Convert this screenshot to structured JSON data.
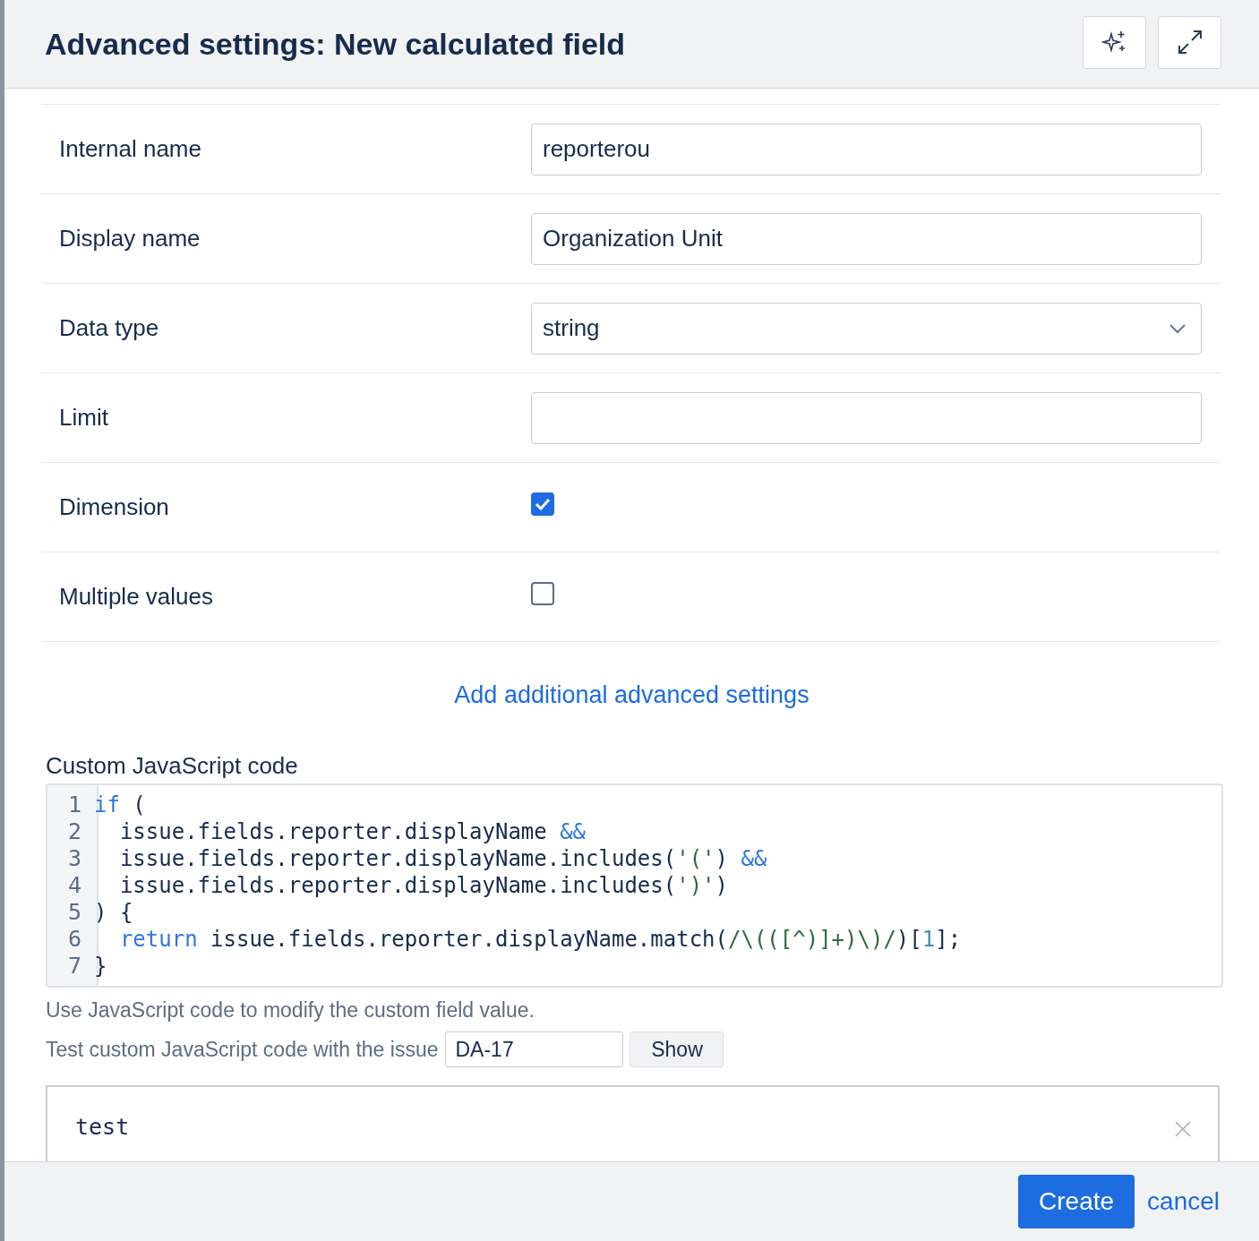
{
  "dialog": {
    "title": "Advanced settings: New calculated field"
  },
  "settings": [
    {
      "kind": "text",
      "label": "Internal name",
      "value": "reporterou"
    },
    {
      "kind": "text",
      "label": "Display name",
      "value": "Organization Unit"
    },
    {
      "kind": "select",
      "label": "Data type",
      "value": "string"
    },
    {
      "kind": "text",
      "label": "Limit"
    },
    {
      "kind": "checkbox",
      "label": "Dimension",
      "checked": true
    },
    {
      "kind": "checkbox",
      "label": "Multiple values",
      "checked": false
    }
  ],
  "add_settings_link": "Add additional advanced settings",
  "code_editor": {
    "label": "Custom JavaScript code",
    "lines": [
      {
        "number": "1",
        "tokens": [
          {
            "kind": "keyword",
            "text": "if"
          },
          {
            "kind": "plain",
            "text": " ("
          }
        ]
      },
      {
        "number": "2",
        "tokens": [
          {
            "kind": "plain",
            "text": "  issue.fields.reporter.displayName "
          },
          {
            "kind": "keyword",
            "text": "&&"
          }
        ]
      },
      {
        "number": "3",
        "tokens": [
          {
            "kind": "plain",
            "text": "  issue.fields.reporter.displayName.includes("
          },
          {
            "kind": "string",
            "text": "'('"
          },
          {
            "kind": "plain",
            "text": ") "
          },
          {
            "kind": "keyword",
            "text": "&&"
          }
        ]
      },
      {
        "number": "4",
        "tokens": [
          {
            "kind": "plain",
            "text": "  issue.fields.reporter.displayName.includes("
          },
          {
            "kind": "string",
            "text": "')'"
          },
          {
            "kind": "plain",
            "text": ")"
          }
        ]
      },
      {
        "number": "5",
        "tokens": [
          {
            "kind": "plain",
            "text": ") {"
          }
        ]
      },
      {
        "number": "6",
        "tokens": [
          {
            "kind": "keyword",
            "text": "  return"
          },
          {
            "kind": "plain",
            "text": " issue.fields.reporter.displayName.match("
          },
          {
            "kind": "string",
            "text": "/\\(([^)]+)\\)/"
          },
          {
            "kind": "plain",
            "text": ")["
          },
          {
            "kind": "number",
            "text": "1"
          },
          {
            "kind": "plain",
            "text": "];"
          }
        ]
      },
      {
        "number": "7",
        "tokens": [
          {
            "kind": "plain",
            "text": "}"
          }
        ]
      }
    ],
    "help": "Use JavaScript code to modify the custom field value."
  },
  "test": {
    "label": "Test custom JavaScript code with the issue",
    "issue": "DA-17",
    "button": "Show",
    "result": "test"
  },
  "footer": {
    "primary": "Create",
    "secondary": "cancel"
  }
}
